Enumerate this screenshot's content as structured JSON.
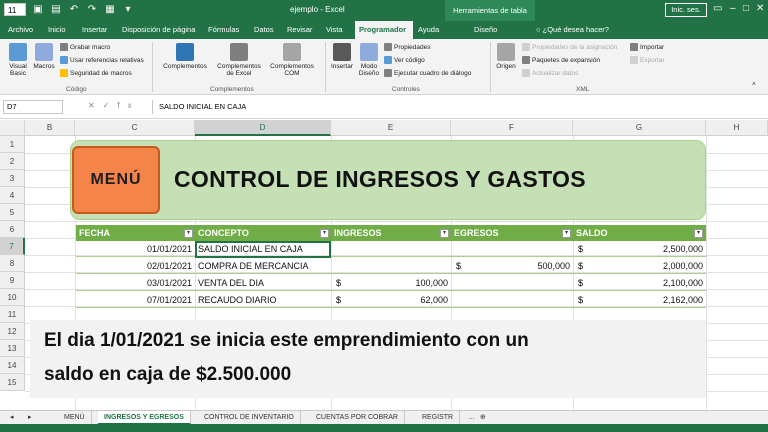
{
  "window": {
    "doc_title": "ejemplo - Excel",
    "context_tab_title": "Herramientas de tabla",
    "login_label": "Inic. ses.",
    "qat_number": "11"
  },
  "tabs": [
    {
      "label": "Archivo"
    },
    {
      "label": "Inicio"
    },
    {
      "label": "Insertar"
    },
    {
      "label": "Disposición de página"
    },
    {
      "label": "Fórmulas"
    },
    {
      "label": "Datos"
    },
    {
      "label": "Revisar"
    },
    {
      "label": "Vista"
    },
    {
      "label": "Programador"
    },
    {
      "label": "Ayuda"
    },
    {
      "label": "Diseño"
    }
  ],
  "tell_me": "¿Qué desea hacer?",
  "ribbon": {
    "codigo": {
      "visual_basic": "Visual Basic",
      "macros": "Macros",
      "grabar_macro": "Grabar macro",
      "usar_ref": "Usar referencias relativas",
      "seguridad": "Seguridad de macros",
      "label": "Código"
    },
    "complementos": {
      "comp": "Complementos",
      "comp_excel": "Complementos de Excel",
      "comp_com": "Complementos COM",
      "label": "Complementos"
    },
    "controles": {
      "insertar": "Insertar",
      "modo": "Modo Diseño",
      "propiedades": "Propiedades",
      "ver_codigo": "Ver código",
      "ejecutar": "Ejecutar cuadro de diálogo",
      "label": "Controles"
    },
    "xml": {
      "origen": "Origen",
      "prop_asig": "Propiedades de la asignación",
      "paquetes": "Paquetes de expansión",
      "actualizar": "Actualizar datos",
      "importar": "Importar",
      "exportar": "Exportar",
      "label": "XML"
    }
  },
  "formula_bar": {
    "name_box": "D7",
    "formula": "SALDO INICIAL EN CAJA"
  },
  "columns": [
    "B",
    "C",
    "D",
    "E",
    "F",
    "G",
    "H"
  ],
  "rows": [
    "1",
    "2",
    "3",
    "4",
    "5",
    "6",
    "7",
    "8",
    "9",
    "10",
    "11",
    "12",
    "13",
    "14",
    "15"
  ],
  "banner": {
    "menu": "MENÚ",
    "title": "CONTROL DE INGRESOS Y GASTOS"
  },
  "table": {
    "headers": [
      "FECHA",
      "CONCEPTO",
      "INGRESOS",
      "EGRESOS",
      "SALDO"
    ],
    "currency": "$",
    "rows": [
      {
        "fecha": "01/01/2021",
        "concepto": "SALDO INICIAL EN CAJA",
        "ingresos": "",
        "egresos": "",
        "saldo": "2,500,000"
      },
      {
        "fecha": "02/01/2021",
        "concepto": "COMPRA DE MERCANCIA",
        "ingresos": "",
        "egresos": "500,000",
        "saldo": "2,000,000"
      },
      {
        "fecha": "03/01/2021",
        "concepto": "VENTA DEL DIA",
        "ingresos": "100,000",
        "egresos": "",
        "saldo": "2,100,000"
      },
      {
        "fecha": "07/01/2021",
        "concepto": "RECAUDO DIARIO",
        "ingresos": "62,000",
        "egresos": "",
        "saldo": "2,162,000"
      }
    ]
  },
  "caption": {
    "line1": "El dia 1/01/2021  se inicia este emprendimiento con un",
    "line2": "saldo en caja de $2.500.000"
  },
  "sheets": [
    {
      "label": "MENÚ"
    },
    {
      "label": "INGRESOS Y EGRESOS"
    },
    {
      "label": "CONTROL DE INVENTARIO"
    },
    {
      "label": "CUENTAS POR COBRAR"
    },
    {
      "label": "REGISTR"
    }
  ],
  "colors": {
    "excel_green": "#217346",
    "table_header": "#70ad47",
    "banner": "#c5e0b4",
    "menu_button": "#f4844a"
  }
}
